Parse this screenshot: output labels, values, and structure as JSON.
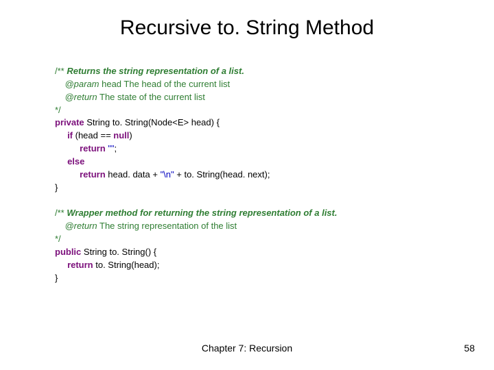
{
  "title": "Recursive to. String Method",
  "code": {
    "c1_open": "/** ",
    "c1_desc": "Returns the string representation of a list.",
    "c1_param_tag": "@param",
    "c1_param_name": " head ",
    "c1_param_desc": "The head of the current list",
    "c1_ret_tag": "@return",
    "c1_ret_desc": " The state of the current list",
    "c1_close": "*/",
    "m1_mod": "private",
    "m1_sig_a": " String to. String(Node<E> head) {",
    "m1_if": "if",
    "m1_if_cond": " (head == ",
    "m1_null": "null",
    "m1_if_close": ")",
    "m1_ret1": "return",
    "m1_empty": " \"\"",
    "m1_semi1": ";",
    "m1_else": "else",
    "m1_ret2": "return",
    "m1_expr_a": " head. data + ",
    "m1_nl": "\"\\n\"",
    "m1_expr_b": " + to. String(head. next);",
    "m1_close": "}",
    "c2_open": "/** ",
    "c2_desc": "Wrapper method for returning the string representation of a list.",
    "c2_ret_tag": "@return",
    "c2_ret_desc": " The string representation of the list",
    "c2_close": "*/",
    "m2_mod": "public",
    "m2_sig": " String to. String() {",
    "m2_ret": "return",
    "m2_body": " to. String(head);",
    "m2_close": "}"
  },
  "footer": {
    "center": "Chapter 7: Recursion",
    "page": "58"
  }
}
